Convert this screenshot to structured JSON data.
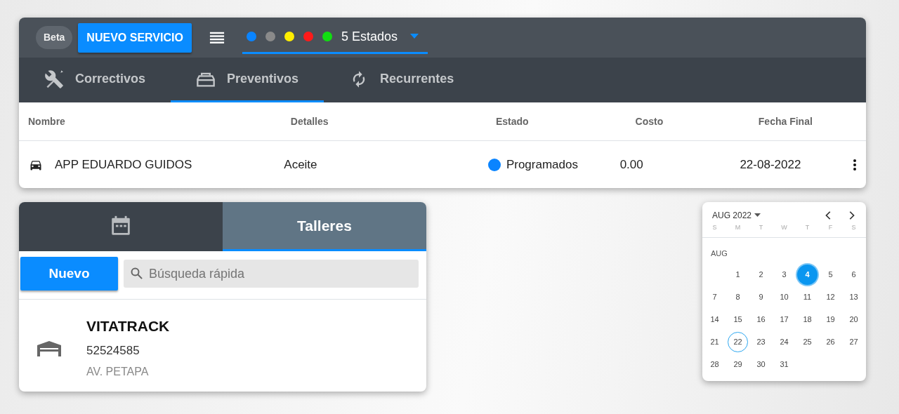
{
  "header": {
    "badge": "Beta",
    "new_button": "NUEVO SERVICIO",
    "status_filter": {
      "dots": [
        {
          "color": "#0a84ff"
        },
        {
          "color": "#8a8a8a"
        },
        {
          "color": "#ffee00"
        },
        {
          "color": "#ff1a1a"
        },
        {
          "color": "#11dd11"
        }
      ],
      "label": "5 Estados"
    }
  },
  "tabs": [
    {
      "label": "Correctivos",
      "kind": "tools",
      "selected": false
    },
    {
      "label": "Preventivos",
      "kind": "toolbox",
      "selected": true
    },
    {
      "label": "Recurrentes",
      "kind": "sync",
      "selected": false
    }
  ],
  "table": {
    "columns": [
      "Nombre",
      "Detalles",
      "Estado",
      "Costo",
      "Fecha Final"
    ],
    "rows": [
      {
        "name": "APP EDUARDO GUIDOS",
        "details": "Aceite",
        "status": {
          "label": "Programados",
          "color": "#0a84ff"
        },
        "cost": "0.00",
        "end_date": "22-08-2022"
      }
    ]
  },
  "side_panel": {
    "tabs": [
      {
        "kind": "calendar",
        "selected": false
      },
      {
        "kind": "text",
        "label": "Talleres",
        "selected": true
      }
    ],
    "new_button": "Nuevo",
    "search": {
      "placeholder": "Búsqueda rápida"
    },
    "workshops": [
      {
        "name": "VITATRACK",
        "phone": "52524585",
        "address": "AV. PETAPA"
      }
    ]
  },
  "calendar": {
    "month_label": "AUG 2022",
    "weekdays": [
      "S",
      "M",
      "T",
      "W",
      "T",
      "F",
      "S"
    ],
    "section": "AUG",
    "weeks": [
      {
        "days": [
          {
            "label": "1",
            "selected": false,
            "today": false
          },
          {
            "label": "2",
            "selected": false,
            "today": false
          },
          {
            "label": "3",
            "selected": false,
            "today": false
          },
          {
            "label": "4",
            "selected": true,
            "today": false
          },
          {
            "label": "5",
            "selected": false,
            "today": false
          },
          {
            "label": "6",
            "selected": false,
            "today": false
          }
        ]
      },
      {
        "days": [
          {
            "label": "7",
            "selected": false,
            "today": false
          },
          {
            "label": "8",
            "selected": false,
            "today": false
          },
          {
            "label": "9",
            "selected": false,
            "today": false
          },
          {
            "label": "10",
            "selected": false,
            "today": false
          },
          {
            "label": "11",
            "selected": false,
            "today": false
          },
          {
            "label": "12",
            "selected": false,
            "today": false
          },
          {
            "label": "13",
            "selected": false,
            "today": false
          }
        ]
      },
      {
        "days": [
          {
            "label": "14",
            "selected": false,
            "today": false
          },
          {
            "label": "15",
            "selected": false,
            "today": false
          },
          {
            "label": "16",
            "selected": false,
            "today": false
          },
          {
            "label": "17",
            "selected": false,
            "today": false
          },
          {
            "label": "18",
            "selected": false,
            "today": false
          },
          {
            "label": "19",
            "selected": false,
            "today": false
          },
          {
            "label": "20",
            "selected": false,
            "today": false
          }
        ]
      },
      {
        "days": [
          {
            "label": "21",
            "selected": false,
            "today": false
          },
          {
            "label": "22",
            "selected": false,
            "today": true
          },
          {
            "label": "23",
            "selected": false,
            "today": false
          },
          {
            "label": "24",
            "selected": false,
            "today": false
          },
          {
            "label": "25",
            "selected": false,
            "today": false
          },
          {
            "label": "26",
            "selected": false,
            "today": false
          },
          {
            "label": "27",
            "selected": false,
            "today": false
          }
        ]
      },
      {
        "days": [
          {
            "label": "28",
            "selected": false,
            "today": false
          },
          {
            "label": "29",
            "selected": false,
            "today": false
          },
          {
            "label": "30",
            "selected": false,
            "today": false
          },
          {
            "label": "31",
            "selected": false,
            "today": false
          }
        ]
      }
    ]
  }
}
